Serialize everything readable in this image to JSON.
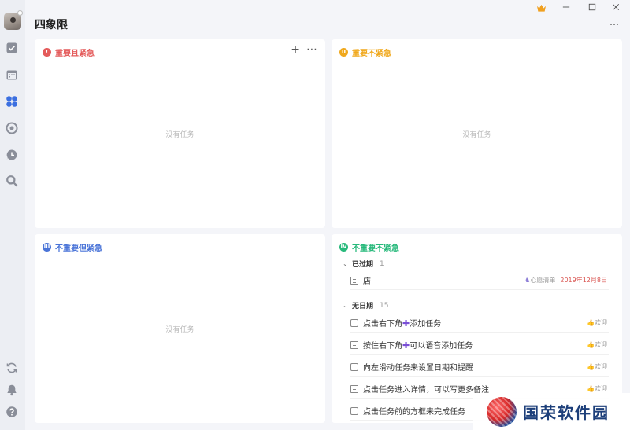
{
  "header": {
    "title": "四象限"
  },
  "quadrants": [
    {
      "title": "重要且紧急",
      "badge": "!",
      "color": "#e45b5b",
      "empty": "没有任务"
    },
    {
      "title": "重要不紧急",
      "badge": "II",
      "color": "#f0a81c",
      "empty": "没有任务"
    },
    {
      "title": "不重要但紧急",
      "badge": "III",
      "color": "#4a74d8",
      "empty": "没有任务"
    },
    {
      "title": "不重要不紧急",
      "badge": "IV",
      "color": "#27b97b"
    }
  ],
  "q1_tools": {
    "add": "+",
    "more": "⋯"
  },
  "top_more": "⋯",
  "groups": {
    "overdue": {
      "name": "已过期",
      "count": "1"
    },
    "no_date": {
      "name": "无日期",
      "count": "15"
    }
  },
  "overdue_tasks": [
    {
      "title": "店",
      "tag": "心愿清单",
      "date": "2019年12月8日"
    }
  ],
  "tasks": [
    {
      "pre": "点击右下角",
      "post": "添加任务",
      "tag": "欢迎"
    },
    {
      "pre": "按住右下角",
      "post": "可以语音添加任务",
      "tag": "欢迎"
    },
    {
      "title": "向左滑动任务来设置日期和提醒",
      "tag": "欢迎"
    },
    {
      "title": "点击任务进入详情，可以写更多备注",
      "tag": "欢迎"
    },
    {
      "title": "点击任务前的方框来完成任务"
    }
  ],
  "watermark": "国荣软件园"
}
